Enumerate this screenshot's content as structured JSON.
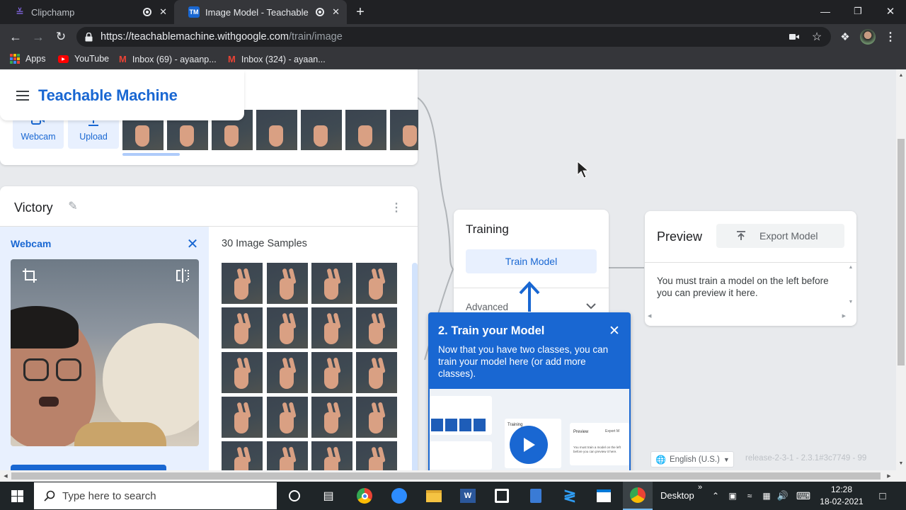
{
  "browser": {
    "tabs": [
      {
        "label": "Clipchamp"
      },
      {
        "label": "Image Model - Teachable Ma"
      }
    ],
    "url_host": "https://teachablemachine.withgoogle.com",
    "url_path": "/train/image",
    "bookmarks": [
      {
        "label": "Apps"
      },
      {
        "label": "YouTube"
      },
      {
        "label": "Inbox (69) - ayaanp..."
      },
      {
        "label": "Inbox (324) - ayaan..."
      }
    ]
  },
  "app": {
    "title": "Teachable Machine",
    "top_card": {
      "webcam_label": "Webcam",
      "upload_label": "Upload"
    },
    "class_card": {
      "name": "Victory",
      "webcam_title": "Webcam",
      "samples_label": "30 Image Samples"
    },
    "training": {
      "title": "Training",
      "train_button": "Train Model",
      "advanced": "Advanced"
    },
    "preview": {
      "title": "Preview",
      "export_button": "Export Model",
      "message": "You must train a model on the left before you can preview it here."
    },
    "tooltip": {
      "title": "2. Train your Model",
      "body": "Now that you have two classes, you can train your model here (or add more classes).",
      "mini_training": "Training",
      "mini_preview": "Preview",
      "mini_export": "Export M",
      "mini_text": "You must train a model on the left before you can preview it here."
    },
    "language": "English (U.S.)",
    "release": "release-2-3-1 - 2.3.1#3c7749 - 99"
  },
  "taskbar": {
    "search_placeholder": "Type here to search",
    "desktop_label": "Desktop",
    "time": "12:28",
    "date": "18-02-2021"
  },
  "colors": {
    "accent": "#1967d2",
    "tooltip_bg": "#1967d2",
    "button_bg": "#e8f0fe"
  }
}
